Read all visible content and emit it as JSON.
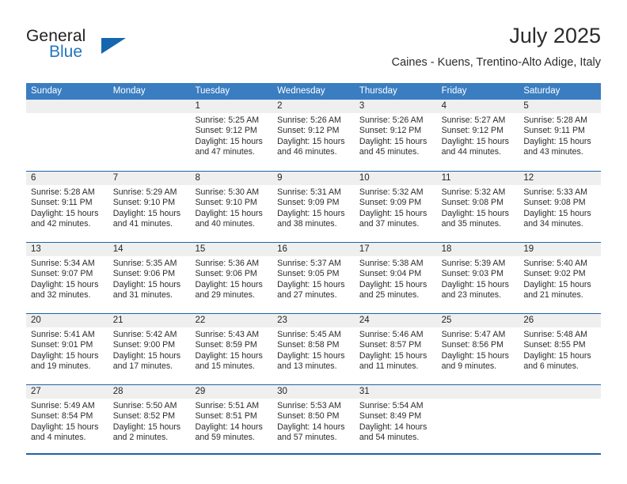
{
  "brand": {
    "name_top": "General",
    "name_bottom": "Blue",
    "triangle_icon": "blue-triangle-logo",
    "color_dark": "#231f20",
    "color_blue": "#2176bd"
  },
  "header": {
    "title": "July 2025",
    "subtitle": "Caines - Kuens, Trentino-Alto Adige, Italy"
  },
  "theme": {
    "header_bar": "#3a7dc0",
    "row_rule": "#1f63a8",
    "day_band": "#efefef"
  },
  "weekdays": [
    "Sunday",
    "Monday",
    "Tuesday",
    "Wednesday",
    "Thursday",
    "Friday",
    "Saturday"
  ],
  "weeks": [
    [
      {
        "day": "",
        "lines": []
      },
      {
        "day": "",
        "lines": []
      },
      {
        "day": "1",
        "lines": [
          "Sunrise: 5:25 AM",
          "Sunset: 9:12 PM",
          "Daylight: 15 hours",
          "and 47 minutes."
        ]
      },
      {
        "day": "2",
        "lines": [
          "Sunrise: 5:26 AM",
          "Sunset: 9:12 PM",
          "Daylight: 15 hours",
          "and 46 minutes."
        ]
      },
      {
        "day": "3",
        "lines": [
          "Sunrise: 5:26 AM",
          "Sunset: 9:12 PM",
          "Daylight: 15 hours",
          "and 45 minutes."
        ]
      },
      {
        "day": "4",
        "lines": [
          "Sunrise: 5:27 AM",
          "Sunset: 9:12 PM",
          "Daylight: 15 hours",
          "and 44 minutes."
        ]
      },
      {
        "day": "5",
        "lines": [
          "Sunrise: 5:28 AM",
          "Sunset: 9:11 PM",
          "Daylight: 15 hours",
          "and 43 minutes."
        ]
      }
    ],
    [
      {
        "day": "6",
        "lines": [
          "Sunrise: 5:28 AM",
          "Sunset: 9:11 PM",
          "Daylight: 15 hours",
          "and 42 minutes."
        ]
      },
      {
        "day": "7",
        "lines": [
          "Sunrise: 5:29 AM",
          "Sunset: 9:10 PM",
          "Daylight: 15 hours",
          "and 41 minutes."
        ]
      },
      {
        "day": "8",
        "lines": [
          "Sunrise: 5:30 AM",
          "Sunset: 9:10 PM",
          "Daylight: 15 hours",
          "and 40 minutes."
        ]
      },
      {
        "day": "9",
        "lines": [
          "Sunrise: 5:31 AM",
          "Sunset: 9:09 PM",
          "Daylight: 15 hours",
          "and 38 minutes."
        ]
      },
      {
        "day": "10",
        "lines": [
          "Sunrise: 5:32 AM",
          "Sunset: 9:09 PM",
          "Daylight: 15 hours",
          "and 37 minutes."
        ]
      },
      {
        "day": "11",
        "lines": [
          "Sunrise: 5:32 AM",
          "Sunset: 9:08 PM",
          "Daylight: 15 hours",
          "and 35 minutes."
        ]
      },
      {
        "day": "12",
        "lines": [
          "Sunrise: 5:33 AM",
          "Sunset: 9:08 PM",
          "Daylight: 15 hours",
          "and 34 minutes."
        ]
      }
    ],
    [
      {
        "day": "13",
        "lines": [
          "Sunrise: 5:34 AM",
          "Sunset: 9:07 PM",
          "Daylight: 15 hours",
          "and 32 minutes."
        ]
      },
      {
        "day": "14",
        "lines": [
          "Sunrise: 5:35 AM",
          "Sunset: 9:06 PM",
          "Daylight: 15 hours",
          "and 31 minutes."
        ]
      },
      {
        "day": "15",
        "lines": [
          "Sunrise: 5:36 AM",
          "Sunset: 9:06 PM",
          "Daylight: 15 hours",
          "and 29 minutes."
        ]
      },
      {
        "day": "16",
        "lines": [
          "Sunrise: 5:37 AM",
          "Sunset: 9:05 PM",
          "Daylight: 15 hours",
          "and 27 minutes."
        ]
      },
      {
        "day": "17",
        "lines": [
          "Sunrise: 5:38 AM",
          "Sunset: 9:04 PM",
          "Daylight: 15 hours",
          "and 25 minutes."
        ]
      },
      {
        "day": "18",
        "lines": [
          "Sunrise: 5:39 AM",
          "Sunset: 9:03 PM",
          "Daylight: 15 hours",
          "and 23 minutes."
        ]
      },
      {
        "day": "19",
        "lines": [
          "Sunrise: 5:40 AM",
          "Sunset: 9:02 PM",
          "Daylight: 15 hours",
          "and 21 minutes."
        ]
      }
    ],
    [
      {
        "day": "20",
        "lines": [
          "Sunrise: 5:41 AM",
          "Sunset: 9:01 PM",
          "Daylight: 15 hours",
          "and 19 minutes."
        ]
      },
      {
        "day": "21",
        "lines": [
          "Sunrise: 5:42 AM",
          "Sunset: 9:00 PM",
          "Daylight: 15 hours",
          "and 17 minutes."
        ]
      },
      {
        "day": "22",
        "lines": [
          "Sunrise: 5:43 AM",
          "Sunset: 8:59 PM",
          "Daylight: 15 hours",
          "and 15 minutes."
        ]
      },
      {
        "day": "23",
        "lines": [
          "Sunrise: 5:45 AM",
          "Sunset: 8:58 PM",
          "Daylight: 15 hours",
          "and 13 minutes."
        ]
      },
      {
        "day": "24",
        "lines": [
          "Sunrise: 5:46 AM",
          "Sunset: 8:57 PM",
          "Daylight: 15 hours",
          "and 11 minutes."
        ]
      },
      {
        "day": "25",
        "lines": [
          "Sunrise: 5:47 AM",
          "Sunset: 8:56 PM",
          "Daylight: 15 hours",
          "and 9 minutes."
        ]
      },
      {
        "day": "26",
        "lines": [
          "Sunrise: 5:48 AM",
          "Sunset: 8:55 PM",
          "Daylight: 15 hours",
          "and 6 minutes."
        ]
      }
    ],
    [
      {
        "day": "27",
        "lines": [
          "Sunrise: 5:49 AM",
          "Sunset: 8:54 PM",
          "Daylight: 15 hours",
          "and 4 minutes."
        ]
      },
      {
        "day": "28",
        "lines": [
          "Sunrise: 5:50 AM",
          "Sunset: 8:52 PM",
          "Daylight: 15 hours",
          "and 2 minutes."
        ]
      },
      {
        "day": "29",
        "lines": [
          "Sunrise: 5:51 AM",
          "Sunset: 8:51 PM",
          "Daylight: 14 hours",
          "and 59 minutes."
        ]
      },
      {
        "day": "30",
        "lines": [
          "Sunrise: 5:53 AM",
          "Sunset: 8:50 PM",
          "Daylight: 14 hours",
          "and 57 minutes."
        ]
      },
      {
        "day": "31",
        "lines": [
          "Sunrise: 5:54 AM",
          "Sunset: 8:49 PM",
          "Daylight: 14 hours",
          "and 54 minutes."
        ]
      },
      {
        "day": "",
        "lines": []
      },
      {
        "day": "",
        "lines": []
      }
    ]
  ]
}
